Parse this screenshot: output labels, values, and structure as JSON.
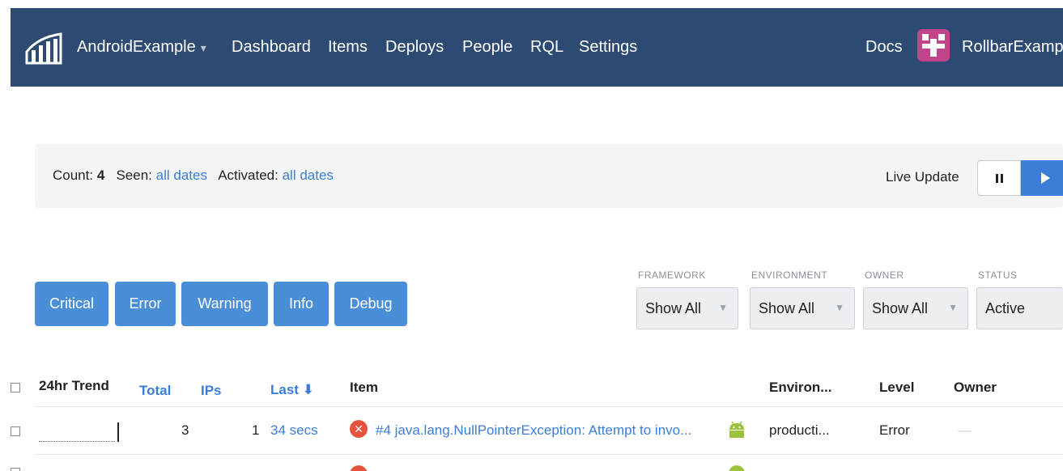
{
  "nav": {
    "project": "AndroidExample",
    "links": [
      "Dashboard",
      "Items",
      "Deploys",
      "People",
      "RQL",
      "Settings"
    ],
    "docs": "Docs",
    "account": "RollbarExamp",
    "colors": {
      "navbar": "#2c4a72",
      "avatar": "#c2458b"
    }
  },
  "summary": {
    "count_label": "Count:",
    "count_value": "4",
    "seen_label": "Seen:",
    "seen_value": "all dates",
    "activated_label": "Activated:",
    "activated_value": "all dates",
    "live_update": "Live Update"
  },
  "levels": [
    "Critical",
    "Error",
    "Warning",
    "Info",
    "Debug"
  ],
  "filters": [
    {
      "label": "FRAMEWORK",
      "value": "Show All"
    },
    {
      "label": "ENVIRONMENT",
      "value": "Show All"
    },
    {
      "label": "OWNER",
      "value": "Show All"
    },
    {
      "label": "STATUS",
      "value": "Active"
    }
  ],
  "table": {
    "headers": {
      "trend": "24hr Trend",
      "total": "Total",
      "ips": "IPs",
      "last": "Last ⬇",
      "item": "Item",
      "environment": "Environ...",
      "level": "Level",
      "owner": "Owner"
    },
    "rows": [
      {
        "total": "3",
        "ips": "1",
        "last": "34 secs",
        "item": "#4 java.lang.NullPointerException: Attempt to invo...",
        "environment": "producti...",
        "level": "Error",
        "owner": "—"
      }
    ]
  },
  "icons": {
    "logo": "rollbar-logo-icon",
    "error": "error-x-icon",
    "platform": "android-icon",
    "pause": "pause-icon",
    "play": "play-icon"
  },
  "accent": "#3b7dd8",
  "level_button_color": "#4a8ed8"
}
